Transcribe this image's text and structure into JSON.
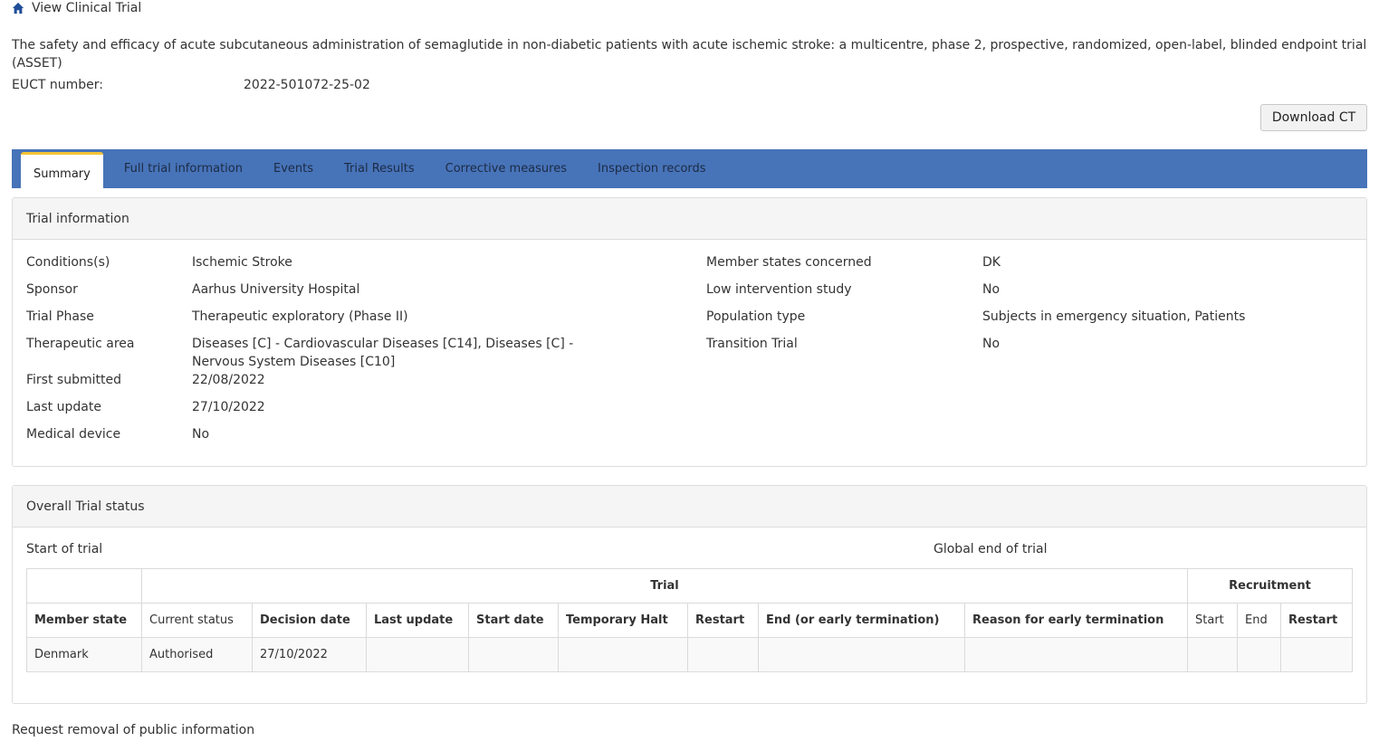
{
  "breadcrumb": {
    "icon": "home-icon",
    "label": "View Clinical Trial"
  },
  "trial_title": "The safety and efficacy of acute subcutaneous administration of semaglutide in non-diabetic patients with acute ischemic stroke: a multicentre, phase 2, prospective, randomized, open-label, blinded endpoint trial (ASSET)",
  "euct": {
    "label": "EUCT number:",
    "value": "2022-501072-25-02"
  },
  "download_label": "Download CT",
  "tabs": [
    "Summary",
    "Full trial information",
    "Events",
    "Trial Results",
    "Corrective measures",
    "Inspection records"
  ],
  "trial_info": {
    "heading": "Trial information",
    "left": [
      {
        "label": "Conditions(s)",
        "value": "Ischemic Stroke"
      },
      {
        "label": "Sponsor",
        "value": "Aarhus University Hospital"
      },
      {
        "label": "Trial Phase",
        "value": "Therapeutic exploratory (Phase II)"
      },
      {
        "label": "Therapeutic area",
        "value": "Diseases [C] - Cardiovascular Diseases [C14], Diseases [C] - Nervous System Diseases [C10]"
      },
      {
        "label": "First submitted",
        "value": "22/08/2022"
      },
      {
        "label": "Last update",
        "value": "27/10/2022"
      },
      {
        "label": "Medical device",
        "value": "No"
      }
    ],
    "right": [
      {
        "label": "Member states concerned",
        "value": "DK"
      },
      {
        "label": "Low intervention study",
        "value": "No"
      },
      {
        "label": "Population type",
        "value": "Subjects in emergency situation, Patients"
      },
      {
        "label": "Transition Trial",
        "value": "No"
      }
    ]
  },
  "status_panel": {
    "heading": "Overall Trial status",
    "start_label": "Start of trial",
    "global_end_label": "Global end of trial",
    "group_headers": {
      "trial": "Trial",
      "recruitment": "Recruitment"
    },
    "columns": {
      "member_state": "Member state",
      "current_status": "Current status",
      "decision_date": "Decision date",
      "last_update": "Last update",
      "start_date": "Start date",
      "temporary_halt": "Temporary Halt",
      "restart": "Restart",
      "end": "End (or early termination)",
      "reason": "Reason for early termination",
      "rec_start": "Start",
      "rec_end": "End",
      "rec_restart": "Restart"
    },
    "rows": [
      {
        "member_state": "Denmark",
        "current_status": "Authorised",
        "decision_date": "27/10/2022"
      }
    ]
  },
  "request_removal": "Request removal of public information"
}
